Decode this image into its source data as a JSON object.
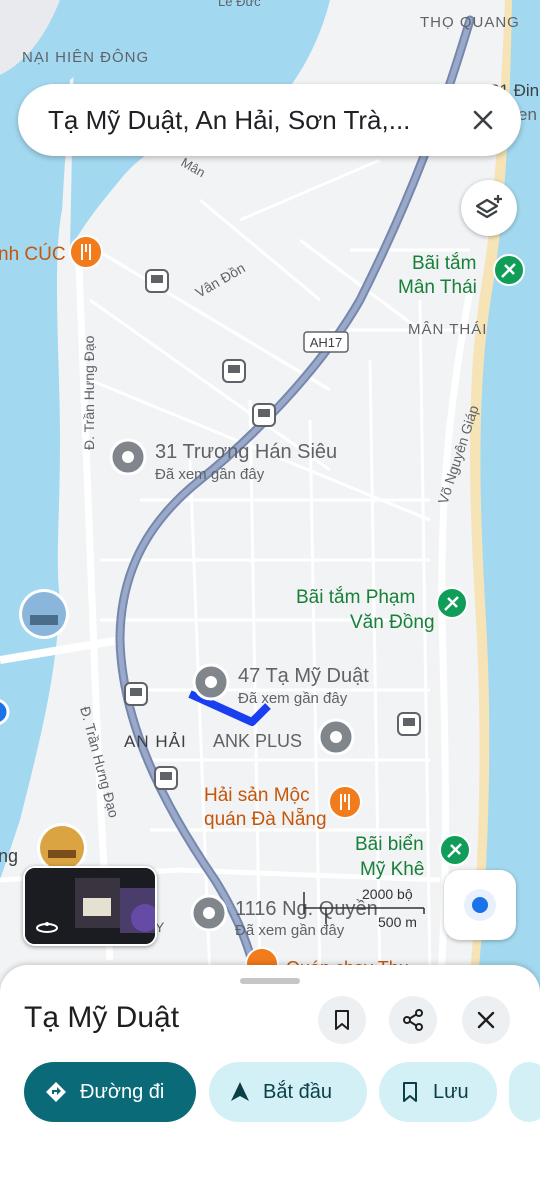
{
  "search": {
    "query": "Tạ Mỹ Duật, An Hải, Sơn Trà,..."
  },
  "map": {
    "area_labels": [
      {
        "text": "NẠI HIÊN ĐÔNG"
      },
      {
        "text": "THỌ QUANG"
      },
      {
        "text": "MÂN THÁI"
      },
      {
        "text": "AN HẢI"
      }
    ],
    "road_labels": [
      {
        "text": "Lê Đức"
      },
      {
        "text": "Vân Đồn"
      },
      {
        "text": "Đ. Trần Hưng Đạo"
      },
      {
        "text": "Đ. Trần Hưng Đạo"
      },
      {
        "text": "Võ Nguyên Giáp"
      },
      {
        "text": "Mân"
      },
      {
        "text": "AH17"
      }
    ],
    "places": [
      {
        "name": "31 Trương Hán Siêu",
        "sub": "Đã xem gần đây"
      },
      {
        "name": "47 Tạ Mỹ Duật",
        "sub": "Đã xem gần đây"
      },
      {
        "name": "1116 Ng. Quyền",
        "sub": "Đã xem gần đây"
      },
      {
        "name": "ANK PLUS"
      }
    ],
    "pois": [
      {
        "name_line1": "Bãi tắm",
        "name_line2": "Mân Thái"
      },
      {
        "name_line1": "Bãi tắm Phạm",
        "name_line2": "Văn Đồng"
      },
      {
        "name_line1": "Bãi biển",
        "name_line2": "Mỹ Khê"
      },
      {
        "name_line1": "Hải sản Mộc",
        "name_line2": "quán Đà Nẵng"
      },
      {
        "name_line1": "nh CÚC"
      }
    ],
    "edge_labels": [
      "31 Đin",
      "en",
      "ng",
      "Y",
      "Quán chay Thu"
    ],
    "scale": {
      "top": "2000 bộ",
      "bottom": "500 m"
    },
    "colors": {
      "water": "#a3d9f0",
      "land": "#f1f3f4",
      "road": "#ffffff",
      "highway": "#8a9bbd",
      "route": "#1a3ff0",
      "beach": "#f6e3b6",
      "poi_green": "#0f9d58",
      "poi_orange": "#f27b1c",
      "pin_grey": "#80868b"
    }
  },
  "sheet": {
    "title": "Tạ Mỹ Duật",
    "icons": [
      "bookmark-icon",
      "share-icon",
      "close-icon"
    ],
    "actions": [
      {
        "label": "Đường đi",
        "icon": "directions-icon"
      },
      {
        "label": "Bắt đầu",
        "icon": "navigation-arrow-icon"
      },
      {
        "label": "Lưu",
        "icon": "bookmark-icon"
      }
    ]
  }
}
